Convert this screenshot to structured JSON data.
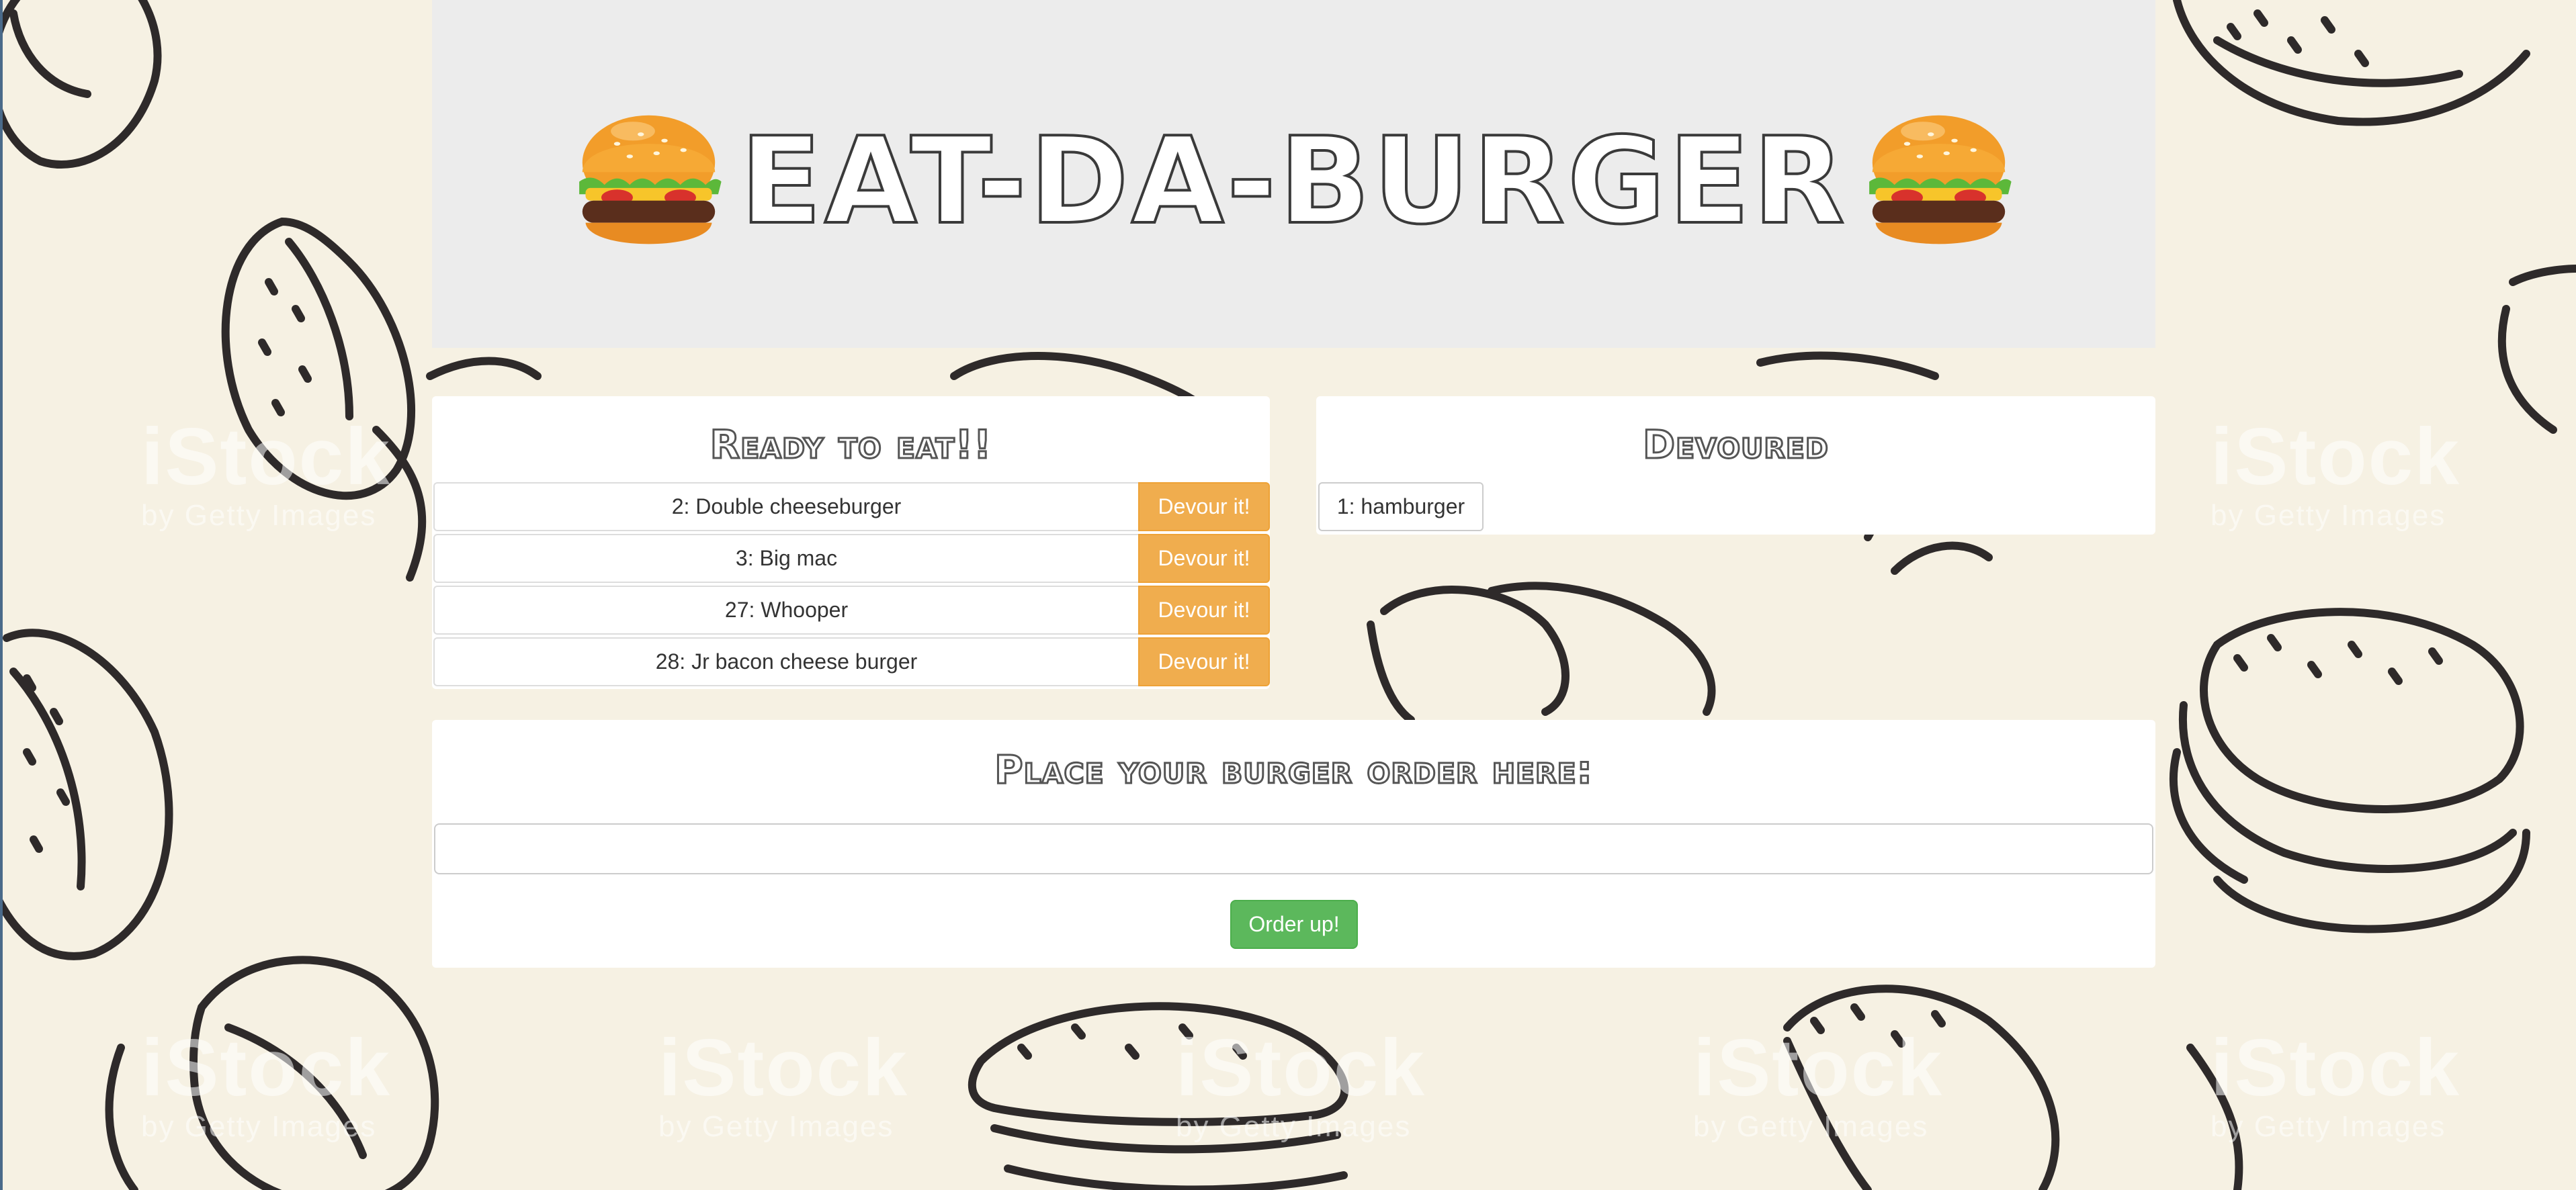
{
  "header": {
    "title": "EAT-DA-BURGER",
    "left_icon": "hamburger-icon",
    "right_icon": "hamburger-icon"
  },
  "ready": {
    "title": "Ready to eat!!",
    "items": [
      {
        "label": "2: Double cheeseburger",
        "button": "Devour it!"
      },
      {
        "label": "3: Big mac",
        "button": "Devour it!"
      },
      {
        "label": "27: Whooper",
        "button": "Devour it!"
      },
      {
        "label": "28: Jr bacon cheese burger",
        "button": "Devour it!"
      }
    ]
  },
  "devoured": {
    "title": "Devoured",
    "items": [
      {
        "label": "1: hamburger"
      }
    ]
  },
  "order": {
    "title": "Place your burger order here:",
    "input_value": "",
    "input_placeholder": "",
    "button": "Order up!"
  },
  "watermark": {
    "brand": "iStock",
    "sub": "by Getty Images"
  },
  "colors": {
    "background": "#f6f1e3",
    "devour_button": "#f0ad4e",
    "order_button": "#5cb85c",
    "jumbotron": "#ececec"
  }
}
